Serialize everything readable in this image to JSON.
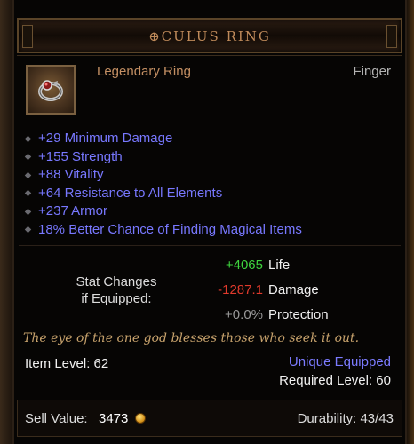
{
  "item": {
    "name": "⊕CULUS RING",
    "type": "Legendary Ring",
    "slot": "Finger",
    "icon": "ring-icon"
  },
  "affixes": [
    "+29 Minimum Damage",
    "+155 Strength",
    "+88 Vitality",
    "+64 Resistance to All Elements",
    "+237 Armor",
    "18% Better Chance of Finding Magical Items"
  ],
  "stat_changes": {
    "caption_line1": "Stat Changes",
    "caption_line2": "if Equipped:",
    "rows": [
      {
        "value": "+4065",
        "label": "Life",
        "color": "#3ed43e"
      },
      {
        "value": "-1287.1",
        "label": "Damage",
        "color": "#e03a2c"
      },
      {
        "value": "+0.0%",
        "label": "Protection",
        "color": "#9a9a9a"
      }
    ]
  },
  "flavor_text": "The eye of the one god blesses those who seek it out.",
  "item_level": "Item Level: 62",
  "unique_equipped": "Unique Equipped",
  "required_level": "Required Level: 60",
  "footer": {
    "sell_label": "Sell Value:",
    "sell_value": "3473",
    "durability": "Durability: 43/43"
  },
  "colors": {
    "title": "#bf8a5a",
    "legendary": "#c38f63",
    "magic_affix": "#7878ff",
    "flavor": "#c7a26c"
  }
}
